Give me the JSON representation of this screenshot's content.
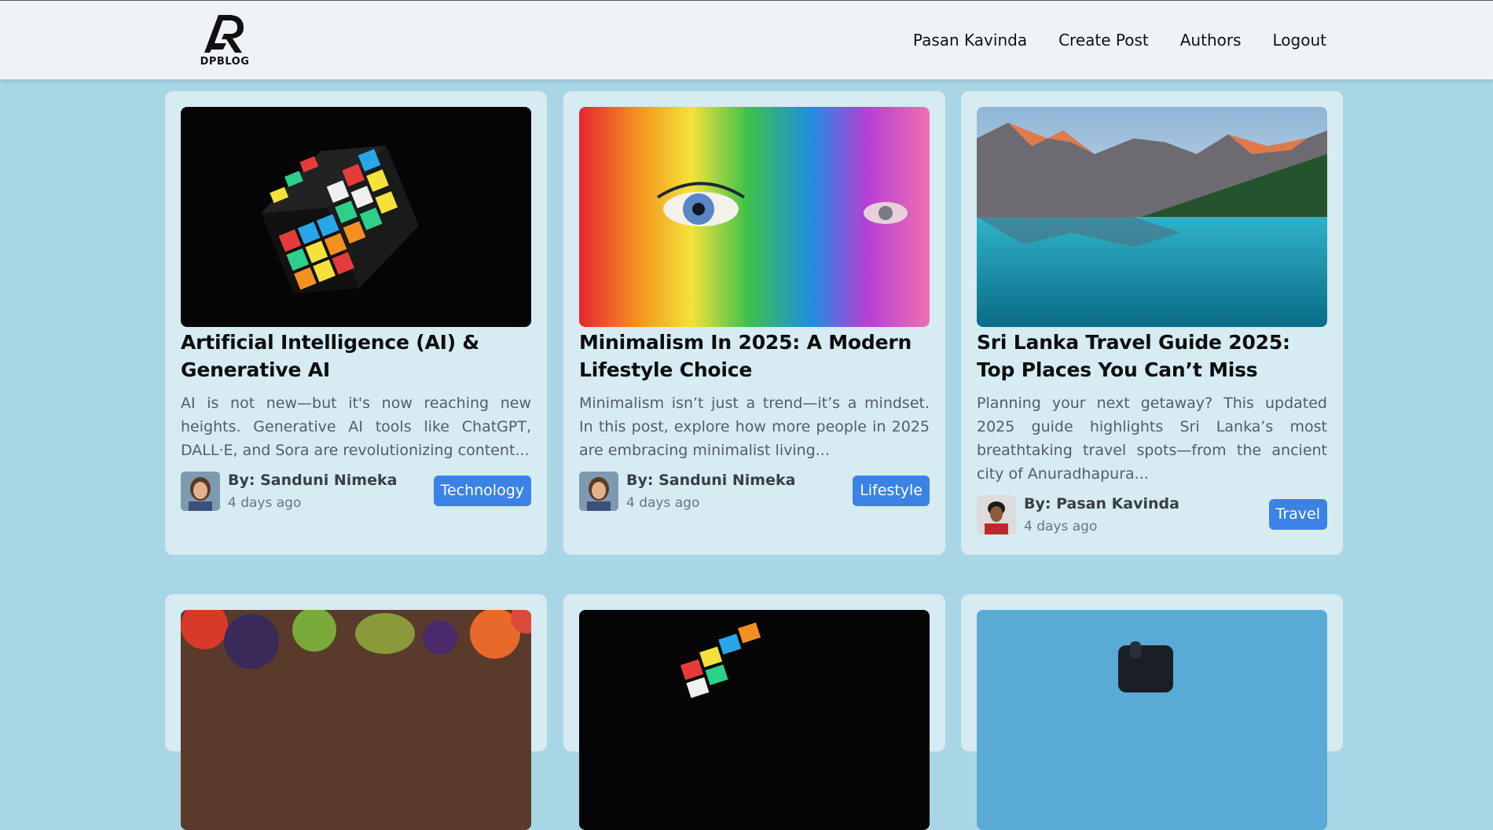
{
  "nav": {
    "logo_text": "DPBLOG",
    "links": [
      "Pasan Kavinda",
      "Create Post",
      "Authors",
      "Logout"
    ]
  },
  "posts": [
    {
      "title": "Artificial Intelligence (AI) & Generative AI",
      "description": "AI is not new—but it's now reaching new heights. Generative AI tools like ChatGPT, DALL·E, and Sora are revolutionizing content...",
      "author": "By: Sanduni Nimeka",
      "date": "4 days ago",
      "category": "Technology"
    },
    {
      "title": "Minimalism In 2025: A Modern Lifestyle Choice",
      "description": "Minimalism isn’t just a trend—it’s a mindset. In this post, explore how more people in 2025 are embracing minimalist living...",
      "author": "By: Sanduni Nimeka",
      "date": "4 days ago",
      "category": "Lifestyle"
    },
    {
      "title": "Sri Lanka Travel Guide 2025: Top Places You Can’t Miss",
      "description": "Planning your next getaway? This updated 2025 guide highlights Sri Lanka’s most breathtaking travel spots—from the ancient city of Anuradhapura...",
      "author": "By: Pasan Kavinda",
      "date": "4 days ago",
      "category": "Travel"
    }
  ]
}
